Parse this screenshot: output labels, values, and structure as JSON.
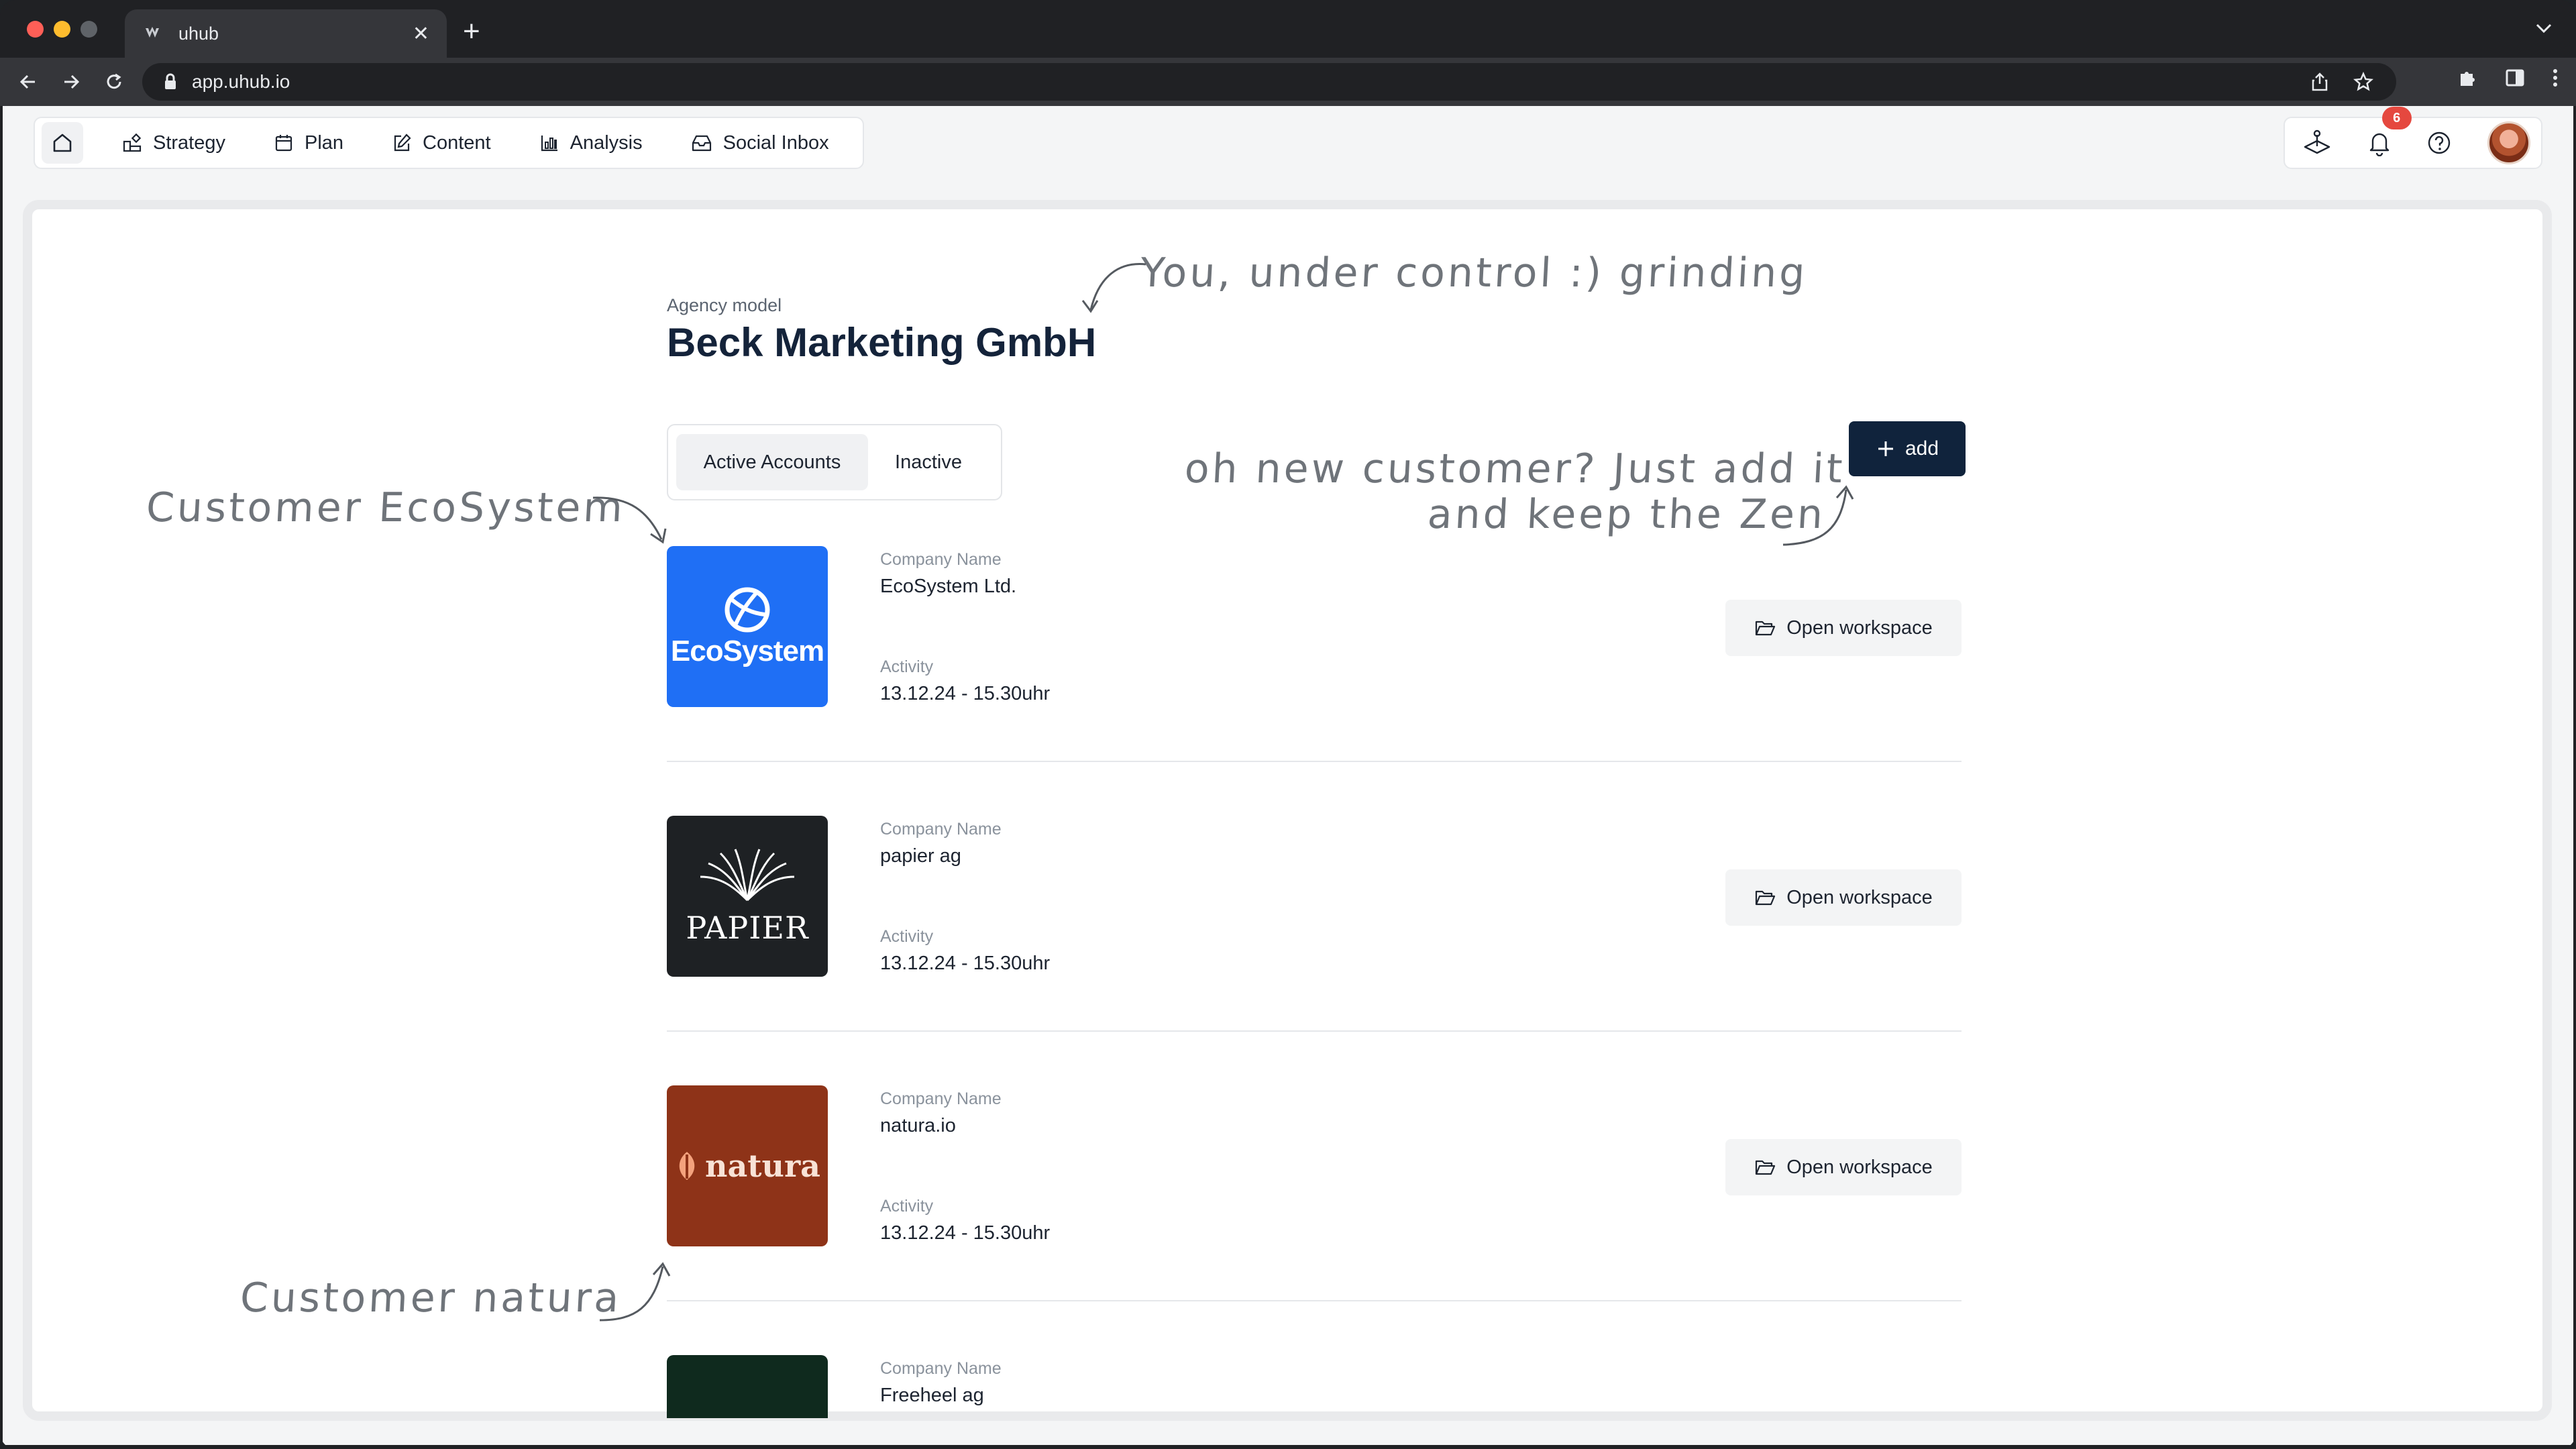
{
  "browser": {
    "tab_title": "uhub",
    "url": "app.uhub.io"
  },
  "topnav": {
    "items": [
      {
        "label": "Strategy",
        "icon": "strategy-icon"
      },
      {
        "label": "Plan",
        "icon": "calendar-icon"
      },
      {
        "label": "Content",
        "icon": "edit-icon"
      },
      {
        "label": "Analysis",
        "icon": "chart-icon"
      },
      {
        "label": "Social Inbox",
        "icon": "inbox-icon"
      }
    ],
    "notification_count": "6"
  },
  "header": {
    "agency_label": "Agency model",
    "agency_name": "Beck Marketing GmbH"
  },
  "segmented": {
    "active_label": "Active Accounts",
    "inactive_label": "Inactive"
  },
  "add_button": {
    "label": "add"
  },
  "accounts": [
    {
      "logo_text": "EcoSystem",
      "logo_color": "#1f6ff5",
      "company_label": "Company Name",
      "company_name": "EcoSystem Ltd.",
      "activity_label": "Activity",
      "activity": "13.12.24 - 15.30uhr",
      "action": "Open workspace"
    },
    {
      "logo_text": "PAPIER",
      "logo_color": "#1e2124",
      "company_label": "Company Name",
      "company_name": "papier ag",
      "activity_label": "Activity",
      "activity": "13.12.24 - 15.30uhr",
      "action": "Open workspace"
    },
    {
      "logo_text": "natura",
      "logo_color": "#8e3318",
      "company_label": "Company Name",
      "company_name": "natura.io",
      "activity_label": "Activity",
      "activity": "13.12.24 - 15.30uhr",
      "action": "Open workspace"
    },
    {
      "logo_text": "",
      "logo_color": "#0f2a1e",
      "company_label": "Company Name",
      "company_name": "Freeheel ag"
    }
  ],
  "annotations": {
    "you": "You, under control :) grinding",
    "ecosystem": "Customer EcoSystem",
    "new_customer_1": "oh new customer? Just add it",
    "new_customer_2": "and keep the Zen",
    "natura": "Customer natura"
  }
}
